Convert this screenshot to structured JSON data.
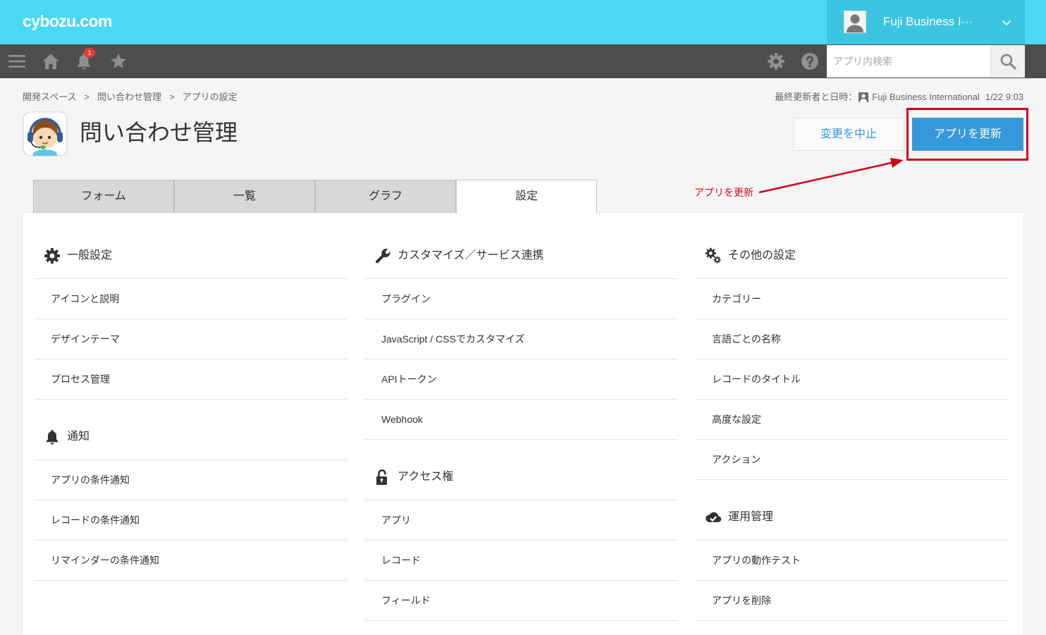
{
  "header": {
    "logo": "cybozu.com",
    "user_name": "Fuji Business I···",
    "avatar_icon": "user-avatar-icon",
    "menu_icon": "chevron-down-icon"
  },
  "toolbar": {
    "left_icons": [
      "menu-icon",
      "home-icon",
      "bell-icon",
      "star-icon"
    ],
    "right_icons": [
      "gear-icon",
      "help-icon"
    ],
    "notification_count": "1",
    "search_placeholder": "アプリ内検索",
    "search_icon": "search-icon"
  },
  "breadcrumb": {
    "items": [
      "開発スペース",
      "問い合わせ管理",
      "アプリの設定"
    ],
    "separator": ">"
  },
  "last_updated": {
    "label": "最終更新者と日時：",
    "user": "Fuji Business International",
    "datetime": "1/22 9:03"
  },
  "app": {
    "title": "問い合わせ管理",
    "icon": "app-support-icon"
  },
  "actions": {
    "cancel": "変更を中止",
    "update": "アプリを更新"
  },
  "annotation": {
    "text": "アプリを更新"
  },
  "tabs": [
    {
      "label": "フォーム",
      "active": false
    },
    {
      "label": "一覧",
      "active": false
    },
    {
      "label": "グラフ",
      "active": false
    },
    {
      "label": "設定",
      "active": true
    }
  ],
  "settings": {
    "columns": [
      [
        {
          "title": "一般設定",
          "icon": "gear-icon",
          "items": [
            "アイコンと説明",
            "デザインテーマ",
            "プロセス管理"
          ]
        },
        {
          "title": "通知",
          "icon": "bell-icon",
          "items": [
            "アプリの条件通知",
            "レコードの条件通知",
            "リマインダーの条件通知"
          ]
        }
      ],
      [
        {
          "title": "カスタマイズ／サービス連携",
          "icon": "wrench-icon",
          "items": [
            "プラグイン",
            "JavaScript / CSSでカスタマイズ",
            "APIトークン",
            "Webhook"
          ]
        },
        {
          "title": "アクセス権",
          "icon": "lock-icon",
          "items": [
            "アプリ",
            "レコード",
            "フィールド"
          ]
        }
      ],
      [
        {
          "title": "その他の設定",
          "icon": "gears-icon",
          "items": [
            "カテゴリー",
            "言語ごとの名称",
            "レコードのタイトル",
            "高度な設定",
            "アクション"
          ]
        },
        {
          "title": "運用管理",
          "icon": "cloud-check-icon",
          "items": [
            "アプリの動作テスト",
            "アプリを削除"
          ]
        }
      ]
    ]
  },
  "colors": {
    "header": "#4ad8f5",
    "user_area": "#3bc5e1",
    "toolbar": "#4d4d4d",
    "primary": "#3498db",
    "annotation": "#d0021b",
    "badge": "#e53935"
  }
}
